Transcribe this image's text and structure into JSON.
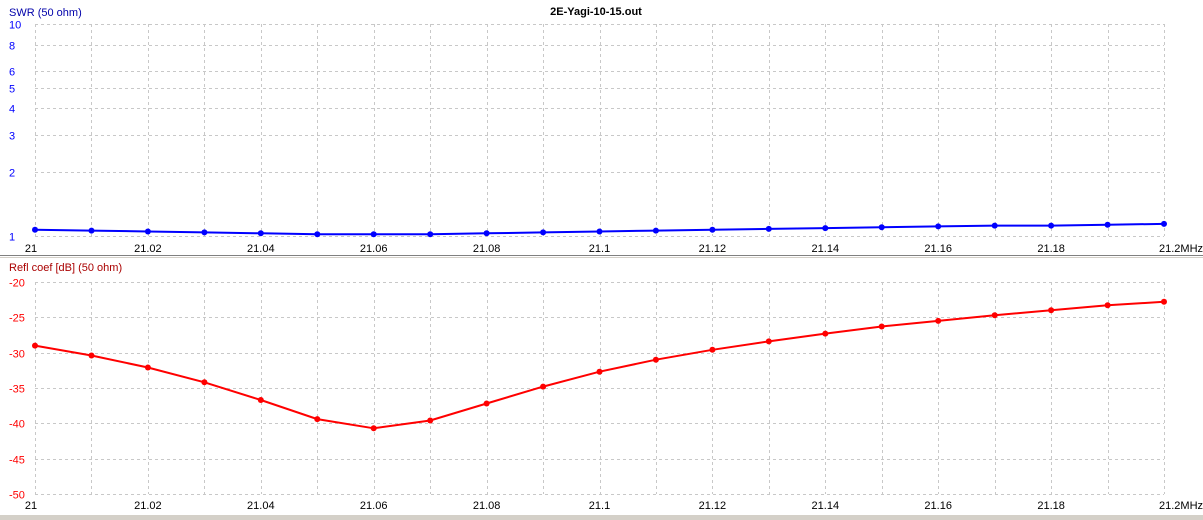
{
  "window_title": "2E-Yagi-10-15.out",
  "chart_data": [
    {
      "type": "line",
      "title": "2E-Yagi-10-15.out",
      "ylabel": "SWR (50 ohm)",
      "xlabel": "",
      "x_unit": "MHz",
      "y_scale": "log",
      "xlim": [
        21,
        21.2
      ],
      "ylim": [
        1,
        10
      ],
      "grid": true,
      "x_ticks": [
        "21",
        "21.02",
        "21.04",
        "21.06",
        "21.08",
        "21.1",
        "21.12",
        "21.14",
        "21.16",
        "21.18",
        "21.2MHz"
      ],
      "y_ticks": [
        "1",
        "2",
        "3",
        "4",
        "5",
        "6",
        "8",
        "10"
      ],
      "color": "#0000ff",
      "series": [
        {
          "x": [
            21.0,
            21.01,
            21.02,
            21.03,
            21.04,
            21.05,
            21.06,
            21.07,
            21.08,
            21.09,
            21.1,
            21.11,
            21.12,
            21.13,
            21.14,
            21.15,
            21.16,
            21.17,
            21.18,
            21.19,
            21.2
          ],
          "y": [
            1.07,
            1.06,
            1.05,
            1.04,
            1.03,
            1.02,
            1.02,
            1.02,
            1.03,
            1.04,
            1.05,
            1.06,
            1.07,
            1.08,
            1.09,
            1.1,
            1.11,
            1.12,
            1.12,
            1.13,
            1.14
          ]
        }
      ]
    },
    {
      "type": "line",
      "title": "",
      "ylabel": "Refl coef [dB] (50 ohm)",
      "xlabel": "",
      "x_unit": "MHz",
      "y_scale": "linear",
      "xlim": [
        21,
        21.2
      ],
      "ylim": [
        -50,
        -20
      ],
      "grid": true,
      "x_ticks": [
        "21",
        "21.02",
        "21.04",
        "21.06",
        "21.08",
        "21.1",
        "21.12",
        "21.14",
        "21.16",
        "21.18",
        "21.2MHz"
      ],
      "y_ticks": [
        "-20",
        "-25",
        "-30",
        "-35",
        "-40",
        "-45",
        "-50"
      ],
      "color": "#ff0000",
      "series": [
        {
          "x": [
            21.0,
            21.01,
            21.02,
            21.03,
            21.04,
            21.05,
            21.06,
            21.07,
            21.08,
            21.09,
            21.1,
            21.11,
            21.12,
            21.13,
            21.14,
            21.15,
            21.16,
            21.17,
            21.18,
            21.19,
            21.2
          ],
          "y": [
            -29.0,
            -30.4,
            -32.1,
            -34.2,
            -36.7,
            -39.4,
            -40.7,
            -39.6,
            -37.2,
            -34.8,
            -32.7,
            -31.0,
            -29.6,
            -28.4,
            -27.3,
            -26.3,
            -25.5,
            -24.7,
            -24.0,
            -23.3,
            -22.8
          ]
        }
      ]
    }
  ]
}
